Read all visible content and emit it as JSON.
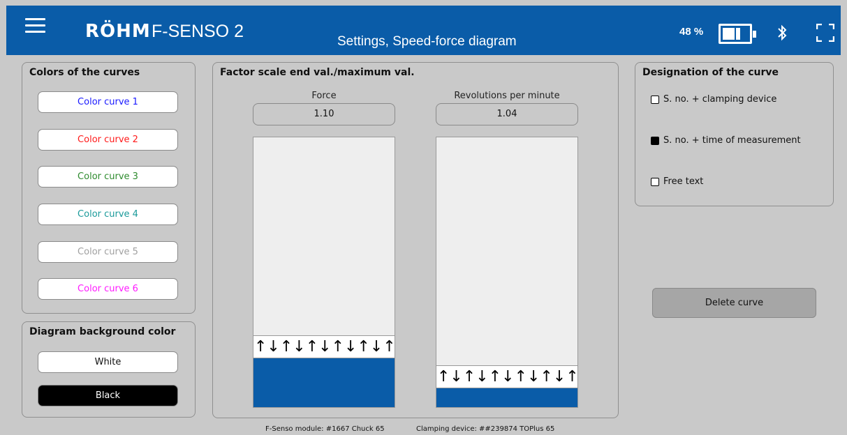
{
  "header": {
    "logo": "RÖHM",
    "product": "F-SENSO 2",
    "screen_title": "Settings, Speed-force diagram",
    "battery_percent": "48 %",
    "battery_level": 0.48
  },
  "colors_panel": {
    "title": "Colors of the curves",
    "buttons": [
      {
        "label": "Color curve 1",
        "color": "#1a1aff"
      },
      {
        "label": "Color curve 2",
        "color": "#ff1a1a"
      },
      {
        "label": "Color curve 3",
        "color": "#2e8b2e"
      },
      {
        "label": "Color curve 4",
        "color": "#1a9a9a"
      },
      {
        "label": "Color curve 5",
        "color": "#a0a0a0"
      },
      {
        "label": "Color curve 6",
        "color": "#ff1aff"
      }
    ]
  },
  "background_panel": {
    "title": "Diagram background color",
    "white_label": "White",
    "black_label": "Black"
  },
  "factor_panel": {
    "title": "Factor scale end val./maximum val.",
    "force": {
      "label": "Force",
      "value": "1.10",
      "level": 0.18
    },
    "rpm": {
      "label": "Revolutions per minute",
      "value": "1.04",
      "level": 0.07
    },
    "arrows": "↑↓↑↓↑↓↑↓↑↓↑↓↑↓↑↓↑↓↑↓↑"
  },
  "designation_panel": {
    "title": "Designation of the curve",
    "options": [
      {
        "label": "S. no. + clamping device",
        "checked": false
      },
      {
        "label": "S. no. + time of measurement",
        "checked": true
      },
      {
        "label": "Free text",
        "checked": false
      }
    ]
  },
  "actions": {
    "delete_label": "Delete curve"
  },
  "footer": {
    "module": "F-Senso module: #1667  Chuck 65",
    "clamping": "Clamping device: ##239874  TOPlus 65"
  },
  "colors": {
    "brand_blue": "#0a5ca8"
  }
}
